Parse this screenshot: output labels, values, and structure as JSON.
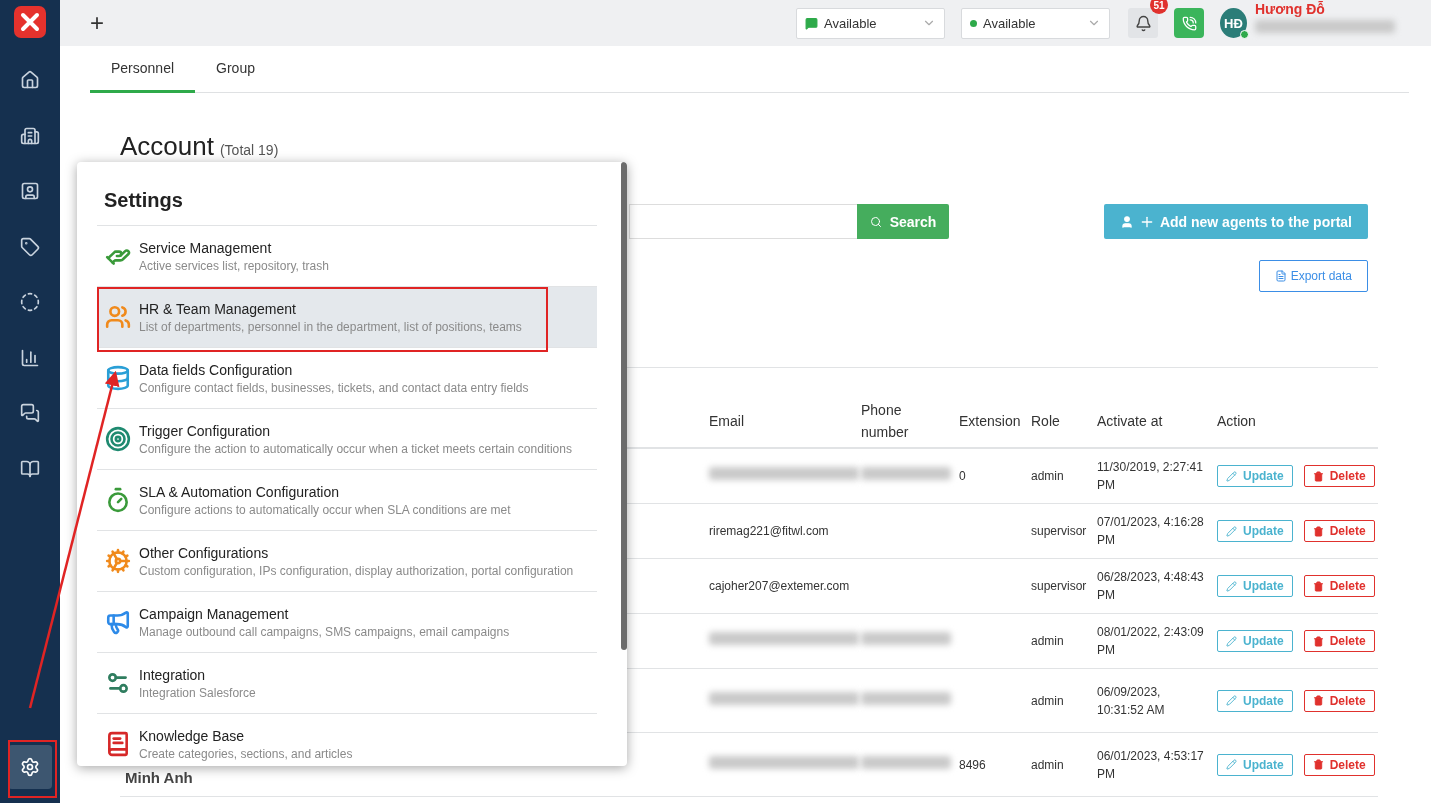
{
  "sidebar": {
    "items": [
      {
        "selected": false
      },
      {
        "selected": false
      },
      {
        "selected": false
      },
      {
        "selected": false
      },
      {
        "selected": false
      },
      {
        "selected": false
      },
      {
        "selected": false
      },
      {
        "selected": false
      }
    ],
    "settings": {
      "selected": true
    }
  },
  "topbar": {
    "add": "+",
    "statuses": [
      {
        "kind": "chat",
        "value": "Available"
      },
      {
        "kind": "dot",
        "value": "Available"
      }
    ],
    "notifications": "51",
    "user": {
      "initials": "HĐ",
      "name": "Hương Đỗ",
      "online": true
    }
  },
  "tabs": [
    {
      "label": "Personnel",
      "selected": true
    },
    {
      "label": "Group",
      "selected": false
    }
  ],
  "page": {
    "title": "Account",
    "total": "(Total 19)",
    "search_button": "Search",
    "add_button": "Add new agents to the portal",
    "export_button": "Export data"
  },
  "table": {
    "columns": [
      "Email",
      "Phone number",
      "Extension",
      "Role",
      "Activate at",
      "Action"
    ],
    "rows": [
      {
        "email": {
          "kind": "blurred"
        },
        "phone": {
          "kind": "blurred"
        },
        "extension": "0",
        "role": "admin",
        "activated": "11/30/2019, 2:27:41 PM",
        "update": "Update",
        "delete": "Delete"
      },
      {
        "email": {
          "kind": "text",
          "text": "riremag221@fitwl.com"
        },
        "phone": {
          "kind": "empty"
        },
        "role": "supervisor",
        "activated": "07/01/2023, 4:16:28 PM",
        "update": "Update",
        "delete": "Delete"
      },
      {
        "email": {
          "kind": "text",
          "text": "cajoher207@extemer.com"
        },
        "phone": {
          "kind": "empty"
        },
        "role": "supervisor",
        "activated": "06/28/2023, 4:48:43 PM",
        "update": "Update",
        "delete": "Delete"
      },
      {
        "email": {
          "kind": "blurred"
        },
        "phone": {
          "kind": "blurred"
        },
        "role": "admin",
        "activated": "08/01/2022, 2:43:09 PM",
        "update": "Update",
        "delete": "Delete"
      },
      {
        "email": {
          "kind": "blurred"
        },
        "phone": {
          "kind": "blurred"
        },
        "role": "admin",
        "activated": "06/09/2023, 10:31:52 AM",
        "update": "Update",
        "delete": "Delete"
      },
      {
        "name": "Minh Anh",
        "email": {
          "kind": "blurred"
        },
        "phone": {
          "kind": "blurred"
        },
        "extension": "8496",
        "role": "admin",
        "activated": "06/01/2023, 4:53:17 PM",
        "update": "Update",
        "delete": "Delete"
      }
    ]
  },
  "settings_menu": {
    "title": "Settings",
    "items": [
      {
        "title": "Service Management",
        "description": "Active services list, repository, trash",
        "selected": false
      },
      {
        "title": "HR & Team Management",
        "description": "List of departments, personnel in the department, list of positions, teams",
        "selected": true
      },
      {
        "title": "Data fields Configuration",
        "description": "Configure contact fields, businesses, tickets, and contact data entry fields",
        "selected": false
      },
      {
        "title": "Trigger Configuration",
        "description": "Configure the action to automatically occur when a ticket meets certain conditions",
        "selected": false
      },
      {
        "title": "SLA & Automation Configuration",
        "description": "Configure actions to automatically occur when SLA conditions are met",
        "selected": false
      },
      {
        "title": "Other Configurations",
        "description": "Custom configuration, IPs configuration, display authorization, portal configuration",
        "selected": false
      },
      {
        "title": "Campaign Management",
        "description": "Manage outbound call campaigns, SMS campaigns, email campaigns",
        "selected": false
      },
      {
        "title": "Integration",
        "description": "Integration Salesforce",
        "selected": false
      },
      {
        "title": "Knowledge Base",
        "description": "Create categories, sections, and articles",
        "selected": false
      }
    ]
  }
}
